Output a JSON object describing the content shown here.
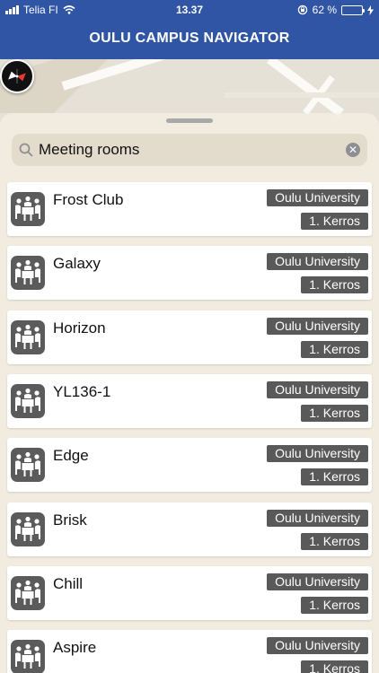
{
  "status_bar": {
    "carrier": "Telia FI",
    "time": "13.37",
    "battery_percent": "62 %",
    "battery_level": 0.62,
    "battery_color": "#4cd964",
    "icons": [
      "signal-icon",
      "wifi-icon",
      "orientation-lock-icon",
      "battery-icon",
      "charging-icon"
    ]
  },
  "header": {
    "title": "OULU CAMPUS NAVIGATOR",
    "background_color": "#2f55a4"
  },
  "map": {
    "compass_icon": "compass-icon"
  },
  "search": {
    "value": "Meeting rooms",
    "placeholder": "",
    "search_icon": "search-icon",
    "clear_icon": "clear-icon"
  },
  "rooms": [
    {
      "name": "Frost Club",
      "organization": "Oulu University",
      "floor": "1. Kerros"
    },
    {
      "name": "Galaxy",
      "organization": "Oulu University",
      "floor": "1. Kerros"
    },
    {
      "name": "Horizon",
      "organization": "Oulu University",
      "floor": "1. Kerros"
    },
    {
      "name": "YL136-1",
      "organization": "Oulu University",
      "floor": "1. Kerros"
    },
    {
      "name": "Edge",
      "organization": "Oulu University",
      "floor": "1. Kerros"
    },
    {
      "name": "Brisk",
      "organization": "Oulu University",
      "floor": "1. Kerros"
    },
    {
      "name": "Chill",
      "organization": "Oulu University",
      "floor": "1. Kerros"
    },
    {
      "name": "Aspire",
      "organization": "Oulu University",
      "floor": "1. Kerros"
    }
  ],
  "room_icon": "meeting-room-icon",
  "tag_color": "#595959"
}
